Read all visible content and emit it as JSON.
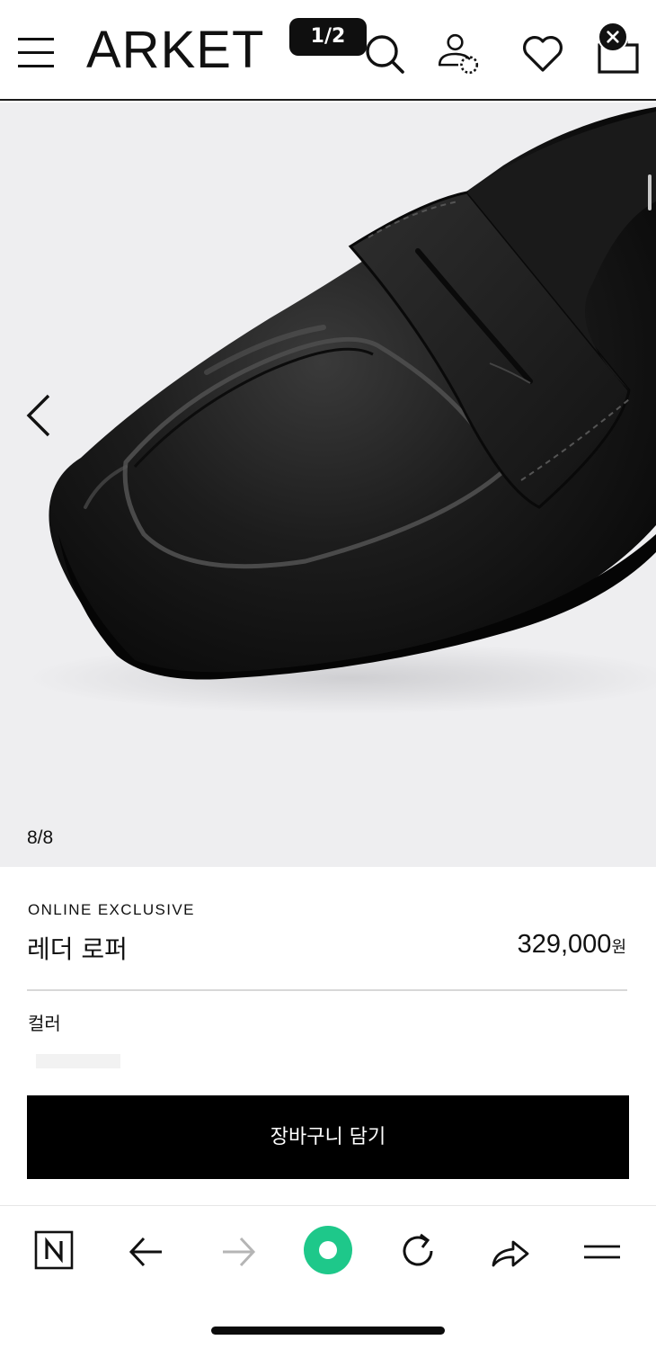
{
  "header": {
    "brand": "ARKET",
    "page_indicator": "1/2",
    "icons": [
      "menu-icon",
      "search-icon",
      "account-icon",
      "wishlist-icon",
      "bag-icon",
      "close-icon"
    ]
  },
  "gallery": {
    "counter": "8/8",
    "background": "#eeeef0"
  },
  "product": {
    "badge": "ONLINE EXCLUSIVE",
    "name": "레더 로퍼",
    "price_value": "329,000",
    "price_currency": "원",
    "color_label": "컬러",
    "add_to_cart_label": "장바구니 담기"
  },
  "browser_bar": {
    "icons": [
      "naver-icon",
      "back-icon",
      "forward-icon",
      "green-dot-icon",
      "refresh-icon",
      "share-icon",
      "menu-icon"
    ],
    "accent": "#1ec88a"
  }
}
